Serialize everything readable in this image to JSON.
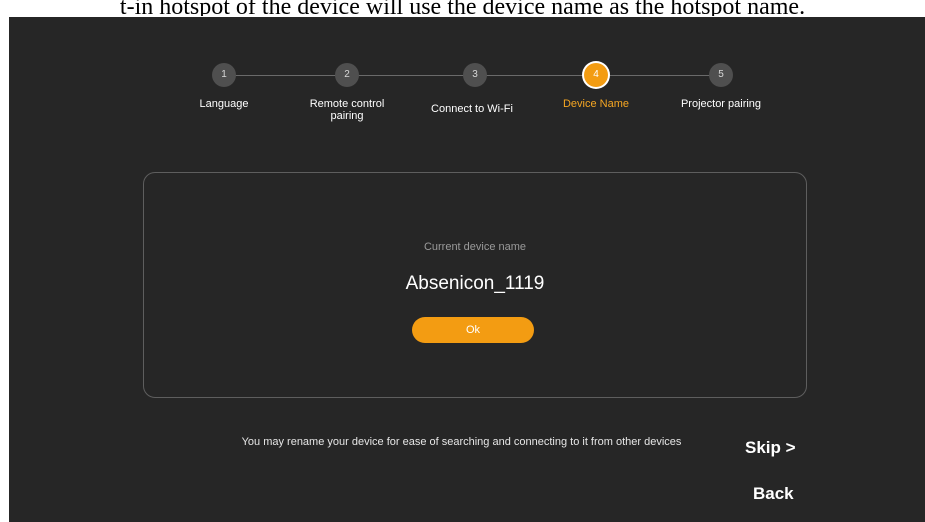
{
  "document": {
    "caption": "t-in hotspot of the device will use the device name as the hotspot name."
  },
  "stepper": {
    "steps": [
      {
        "number": "1",
        "label": "Language"
      },
      {
        "number": "2",
        "label": "Remote control pairing",
        "label_line1": "Remote control",
        "label_line2": "pairing"
      },
      {
        "number": "3",
        "label": "Connect to Wi-Fi"
      },
      {
        "number": "4",
        "label": "Device Name",
        "active": true
      },
      {
        "number": "5",
        "label": "Projector pairing"
      }
    ],
    "active_color": "#f39c12"
  },
  "card": {
    "label": "Current device name",
    "device_name": "Absenicon_1119",
    "ok_label": "Ok"
  },
  "footer": {
    "hint": "You may rename your device for ease of searching and connecting to it from other devices",
    "skip_label": "Skip >",
    "back_label": "Back"
  },
  "colors": {
    "background": "#262626",
    "accent": "#f39c12"
  }
}
